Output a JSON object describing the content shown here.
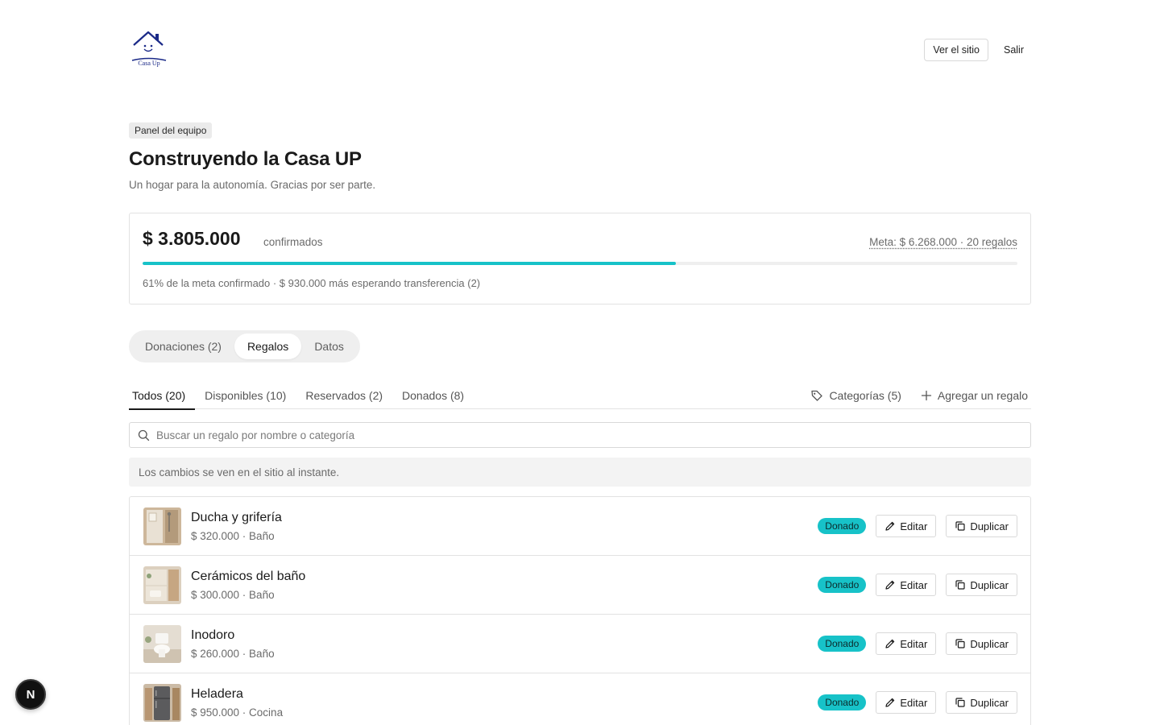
{
  "header": {
    "logo_text": "Casa Up",
    "view_site_label": "Ver el sitio",
    "logout_label": "Salir"
  },
  "panel_badge": "Panel del equipo",
  "title": "Construyendo la Casa UP",
  "subtitle": "Un hogar para la autonomía. Gracias por ser parte.",
  "summary": {
    "amount": "$ 3.805.000",
    "amount_label": "confirmados",
    "goal": "Meta: $ 6.268.000 · 20 regalos",
    "progress_percent": 61,
    "note": "61% de la meta confirmado · $ 930.000 más esperando transferencia (2)"
  },
  "segments": [
    {
      "label": "Donaciones (2)",
      "active": false
    },
    {
      "label": "Regalos",
      "active": true
    },
    {
      "label": "Datos",
      "active": false
    }
  ],
  "filter_tabs": [
    {
      "label": "Todos (20)",
      "active": true
    },
    {
      "label": "Disponibles (10)",
      "active": false
    },
    {
      "label": "Reservados (2)",
      "active": false
    },
    {
      "label": "Donados (8)",
      "active": false
    }
  ],
  "filter_actions": {
    "categories_label": "Categorías (5)",
    "add_label": "Agregar un regalo"
  },
  "search": {
    "placeholder": "Buscar un regalo por nombre o categoría",
    "value": ""
  },
  "info": "Los cambios se ven en el sitio al instante.",
  "gifts": [
    {
      "name": "Ducha y grifería",
      "meta": "$ 320.000 · Baño",
      "status": "Donado",
      "edit_label": "Editar",
      "duplicate_label": "Duplicar"
    },
    {
      "name": "Cerámicos del baño",
      "meta": "$ 300.000 · Baño",
      "status": "Donado",
      "edit_label": "Editar",
      "duplicate_label": "Duplicar"
    },
    {
      "name": "Inodoro",
      "meta": "$ 260.000 · Baño",
      "status": "Donado",
      "edit_label": "Editar",
      "duplicate_label": "Duplicar"
    },
    {
      "name": "Heladera",
      "meta": "$ 950.000 · Cocina",
      "status": "Donado",
      "edit_label": "Editar",
      "duplicate_label": "Duplicar"
    }
  ],
  "dev_badge": "N",
  "colors": {
    "accent": "#17c2c8",
    "logo": "#1b2a88"
  }
}
